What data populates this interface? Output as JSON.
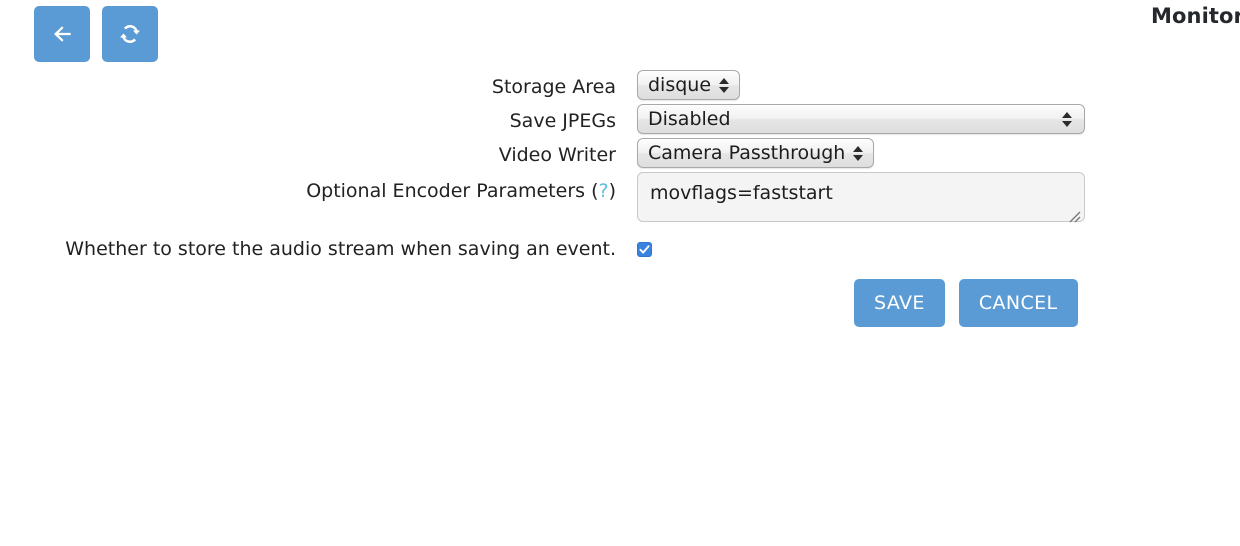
{
  "page": {
    "title": "Monitor"
  },
  "toolbar": {
    "back": {
      "name": "back-button",
      "icon": "arrow-left-icon"
    },
    "refresh": {
      "name": "refresh-button",
      "icon": "refresh-icon"
    }
  },
  "form": {
    "rows": [
      {
        "label": "Storage Area",
        "value": "disque",
        "control": "select"
      },
      {
        "label": "Save JPEGs",
        "value": "Disabled",
        "control": "select"
      },
      {
        "label": "Video Writer",
        "value": "Camera Passthrough",
        "control": "select"
      }
    ],
    "encoder": {
      "label_prefix": "Optional Encoder Parameters (",
      "help": "?",
      "label_suffix": ")",
      "value": "movflags=faststart",
      "placeholder": ""
    }
  },
  "audio": {
    "label": "Whether to store the audio stream when saving an event.",
    "checked": true,
    "check_glyph": "✓"
  },
  "actions": {
    "save_label": "SAVE",
    "cancel_label": "CANCEL"
  },
  "colors": {
    "accent_blue": "#5b9bd5",
    "checkbox_blue": "#3b82e0",
    "help_link": "#5bc0de",
    "title": "#25282d",
    "background": "#ffffff"
  }
}
